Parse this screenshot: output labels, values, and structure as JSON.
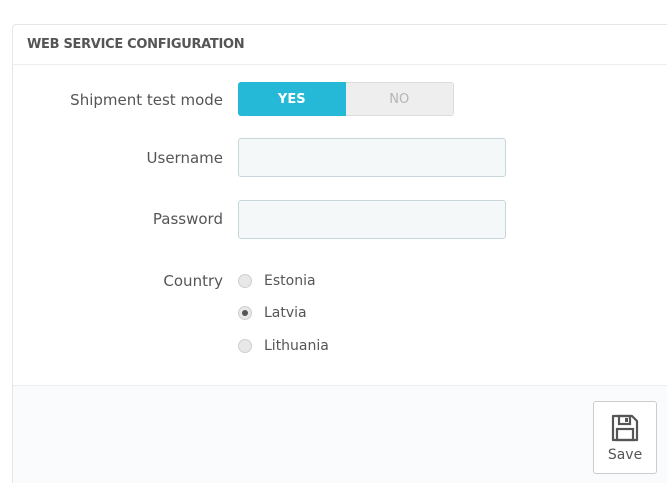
{
  "panel": {
    "title": "WEB SERVICE CONFIGURATION"
  },
  "form": {
    "test_mode": {
      "label": "Shipment test mode",
      "yes_label": "YES",
      "no_label": "NO",
      "value": "YES"
    },
    "username": {
      "label": "Username",
      "value": "",
      "placeholder": ""
    },
    "password": {
      "label": "Password",
      "value": "",
      "placeholder": ""
    },
    "country": {
      "label": "Country",
      "options": [
        {
          "label": "Estonia",
          "checked": false
        },
        {
          "label": "Latvia",
          "checked": true
        },
        {
          "label": "Lithuania",
          "checked": false
        }
      ]
    }
  },
  "footer": {
    "save_label": "Save",
    "save_icon": "floppy-disk-icon"
  },
  "colors": {
    "accent": "#25b9d7",
    "input_bg": "#f5f8f9",
    "input_border": "#c7d6db"
  }
}
